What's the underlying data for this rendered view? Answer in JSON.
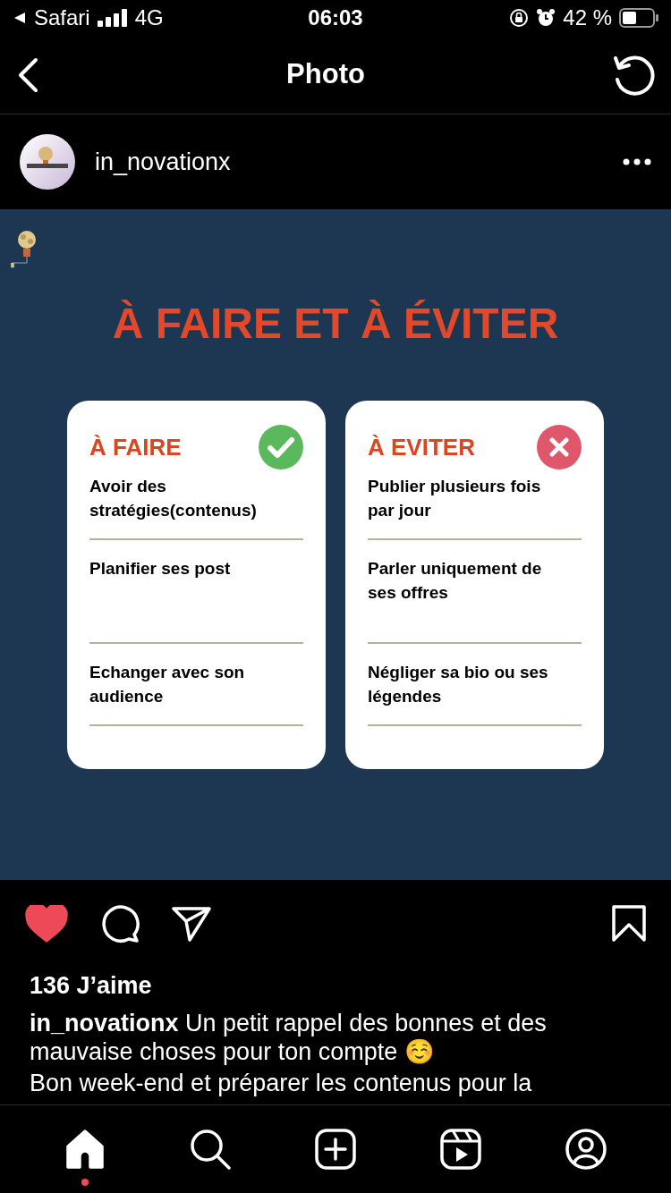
{
  "status_bar": {
    "back_app": "Safari",
    "network": "4G",
    "time": "06:03",
    "battery": "42 %"
  },
  "header": {
    "title": "Photo"
  },
  "post": {
    "username": "in_novationx",
    "image": {
      "title": "À FAIRE ET À ÉVITER",
      "cards": [
        {
          "kind": "do",
          "heading": "À FAIRE",
          "items": [
            "Avoir des stratégies(contenus)",
            "Planifier ses post",
            "Echanger avec son audience"
          ]
        },
        {
          "kind": "dont",
          "heading": "À EVITER",
          "items": [
            "Publier plusieurs fois par jour",
            "Parler uniquement de ses offres",
            "Négliger sa bio ou ses légendes"
          ]
        }
      ]
    },
    "liked": true,
    "likes": "136 J’aime",
    "caption": {
      "username": "in_novationx",
      "text": "Un petit rappel des bonnes et des mauvaise choses pour ton compte ☺️",
      "second_line": "Bon week-end et préparer les contenus pour la"
    }
  },
  "tab_bar": [
    {
      "kind": "home",
      "selected": true,
      "badge": true
    },
    {
      "kind": "search",
      "selected": false,
      "badge": false
    },
    {
      "kind": "create",
      "selected": false,
      "badge": false
    },
    {
      "kind": "reels",
      "selected": false,
      "badge": false
    },
    {
      "kind": "profile",
      "selected": false,
      "badge": false
    }
  ]
}
